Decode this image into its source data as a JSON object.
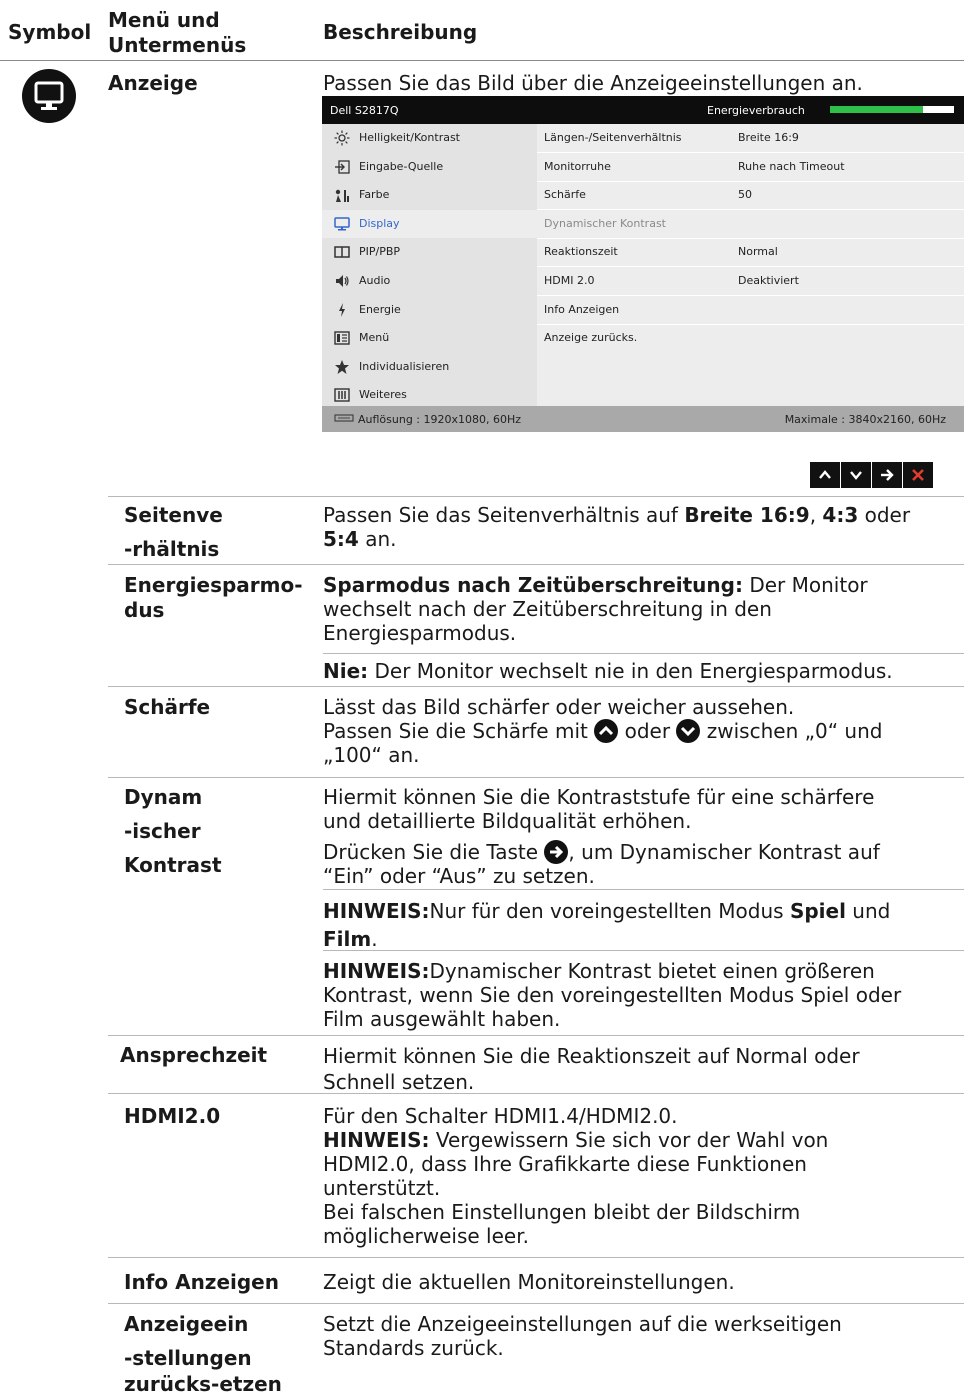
{
  "header": {
    "col_symbol": "Symbol",
    "col_menu": "Menü und Untermenüs",
    "col_desc": "Beschreibung"
  },
  "section": {
    "icon": "monitor-icon",
    "title": "Anzeige",
    "intro": "Passen Sie das Bild über die Anzeigeeinstellungen an."
  },
  "osd": {
    "model": "Dell S2817Q",
    "energy_label": "Energieverbrauch",
    "energy_level": 0.75,
    "menu": [
      {
        "icon": "brightness-icon",
        "label": "Helligkeit/Kontrast"
      },
      {
        "icon": "input-source-icon",
        "label": "Eingabe-Quelle"
      },
      {
        "icon": "color-icon",
        "label": "Farbe"
      },
      {
        "icon": "display-icon",
        "label": "Display",
        "active": true
      },
      {
        "icon": "pip-icon",
        "label": "PIP/PBP"
      },
      {
        "icon": "audio-icon",
        "label": "Audio"
      },
      {
        "icon": "energy-icon",
        "label": "Energie"
      },
      {
        "icon": "menu-icon",
        "label": "Menü"
      },
      {
        "icon": "star-icon",
        "label": "Individualisieren"
      },
      {
        "icon": "others-icon",
        "label": "Weiteres"
      }
    ],
    "settings": [
      {
        "name": "Längen-/Seitenverhältnis",
        "value": "Breite 16:9"
      },
      {
        "name": "Monitorruhe",
        "value": "Ruhe nach Timeout"
      },
      {
        "name": "Schärfe",
        "value": "50"
      },
      {
        "name": "Dynamischer Kontrast",
        "value": "",
        "dim": true
      },
      {
        "name": "Reaktionszeit",
        "value": "Normal"
      },
      {
        "name": "HDMI 2.0",
        "value": "Deaktiviert"
      },
      {
        "name": "Info Anzeigen",
        "value": ""
      },
      {
        "name": "Anzeige zurücks.",
        "value": ""
      }
    ],
    "resolution": "Auflösung : 1920x1080, 60Hz",
    "max_resolution": "Maximale : 3840x2160, 60Hz"
  },
  "nav_buttons": [
    {
      "icon": "chevron-up-icon"
    },
    {
      "icon": "chevron-down-icon"
    },
    {
      "icon": "arrow-right-icon"
    },
    {
      "icon": "close-icon",
      "color": "#e03c2f"
    }
  ],
  "rows": {
    "aspect": {
      "name_1": "Seitenve",
      "name_2": "-rhältnis",
      "d_pre": "Passen Sie das Seitenverhältnis auf ",
      "d_b1": "Breite 16:9",
      "d_sep1": ", ",
      "d_b2": "4:3",
      "d_sep2": " oder",
      "d_b3": "5:4",
      "d_post": " an."
    },
    "energy": {
      "name_1": "Energiesparmo-",
      "name_2": "dus",
      "t_bold": "Sparmodus nach Zeitüberschreitung:",
      "t_rest": " Der Monitor",
      "t_l2": "wechselt nach der Zeitüberschreitung in den",
      "t_l3": "Energiesparmodus.",
      "n_bold": "Nie:",
      "n_rest": " Der Monitor wechselt nie in den Energiesparmodus."
    },
    "sharp": {
      "name": "Schärfe",
      "l1": "Lässt das Bild schärfer oder weicher aussehen.",
      "l2_a": "Passen Sie die Schärfe mit ",
      "l2_b": " oder ",
      "l2_c": " zwischen „0“ und",
      "l3": "„100“ an."
    },
    "dyn": {
      "name_1": "Dynam",
      "name_2": "-ischer",
      "name_3": "Kontrast",
      "p1_l1": "Hiermit können Sie die Kontraststufe für eine schärfere",
      "p1_l2": "und detaillierte Bildqualität erhöhen.",
      "p2_a": "Drücken Sie die Taste ",
      "p2_b": ", um Dynamischer Kontrast auf",
      "p2_l2": "“Ein” oder “Aus” zu setzen.",
      "n1_b": "HINWEIS:",
      "n1_a": "Nur für den voreingestellten Modus ",
      "n1_b2": "Spiel",
      "n1_c": " und",
      "n1_b3": "Film",
      "n1_d": ".",
      "n2_b": "HINWEIS:",
      "n2_l1": "Dynamischer Kontrast bietet einen größeren",
      "n2_l2": "Kontrast, wenn Sie den voreingestellten Modus Spiel oder",
      "n2_l3": "Film ausgewählt haben."
    },
    "resp": {
      "name": "Ansprechzeit",
      "l1": "Hiermit können Sie die Reaktionszeit auf Normal oder",
      "l2": "Schnell setzen."
    },
    "hdmi": {
      "name": "HDMI2.0",
      "l1": "Für den Schalter HDMI1.4/HDMI2.0.",
      "n_b": "HINWEIS:",
      "n_l1": " Vergewissern Sie sich vor der Wahl von",
      "l3": "HDMI2.0, dass Ihre Grafikkarte diese Funktionen",
      "l4": "unterstützt.",
      "l5": "Bei falschen Einstellungen bleibt der Bildschirm",
      "l6": "möglicherweise leer."
    },
    "info": {
      "name": "Info Anzeigen",
      "l1": "Zeigt die aktuellen Monitoreinstellungen."
    },
    "reset": {
      "name_1": "Anzeigeein",
      "name_2": "-stellungen",
      "name_3": "zurücks-etzen",
      "l1": "Setzt die Anzeigeeinstellungen auf die werkseitigen",
      "l2": "Standards zurück."
    }
  }
}
